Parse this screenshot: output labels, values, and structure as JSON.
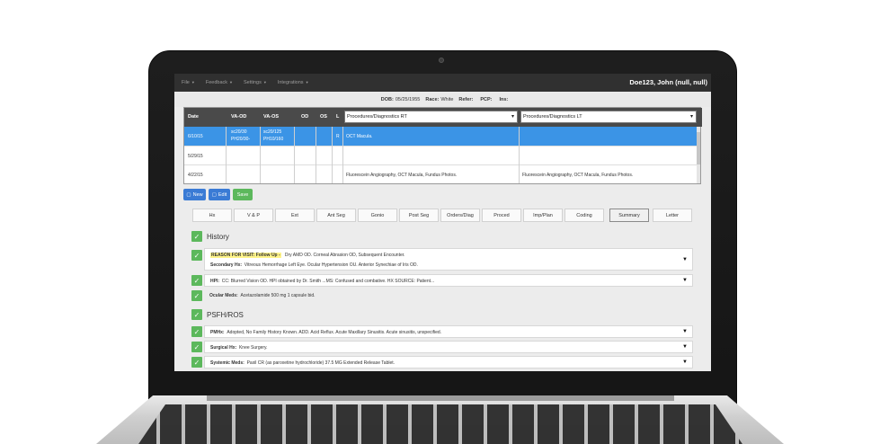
{
  "header": {
    "menus": [
      "File",
      "Feedback",
      "Settings",
      "Integrations"
    ],
    "patient_name": "Doe123, John (null, null)"
  },
  "infobar": {
    "dob_label": "DOB:",
    "dob": "05/25/1955",
    "race_label": "Race:",
    "race": "White",
    "refer_label": "Refer:",
    "pcp_label": "PCP:",
    "ins_label": "Ins:"
  },
  "grid": {
    "columns": [
      "Date",
      "VA-OD",
      "VA-OS",
      "OD",
      "OS",
      "L"
    ],
    "dropdown_rt": "Procedures/Diagnostics RT",
    "dropdown_lt": "Procedures/Diagnostics LT",
    "rows": [
      {
        "date": "6/10/15",
        "va_od_1": "sc20/30",
        "va_od_2": "PH20/30-",
        "va_os_1": "sc20/125",
        "va_os_2": "PH10/160",
        "l": "R",
        "rt": "OCT Macula.",
        "lt": ""
      },
      {
        "date": "5/29/15",
        "va_od_1": "",
        "va_od_2": "",
        "va_os_1": "",
        "va_os_2": "",
        "l": "",
        "rt": "",
        "lt": ""
      },
      {
        "date": "4/22/15",
        "va_od_1": "",
        "va_od_2": "",
        "va_os_1": "",
        "va_os_2": "",
        "l": "",
        "rt": "Fluorescein Angiography, OCT Macula, Fundus Photos.",
        "lt": "Fluorescein Angiography, OCT Macula, Fundus Photos."
      }
    ]
  },
  "buttons": {
    "new": "New",
    "edit": "Edit",
    "save": "Save"
  },
  "tabs": [
    "Hx",
    "V & P",
    "Ext",
    "Ant Seg",
    "Gonio",
    "Post Seg",
    "Orders/Diag",
    "Proced",
    "Imp/Plan",
    "Coding",
    "Summary",
    "Letter"
  ],
  "active_tab": "Summary",
  "history": {
    "title": "History",
    "reason_label": "REASON FOR VISIT: Follow Up -",
    "reason_text": "Dry AMD OD.  Corneal Abrasion OD, Subsequent Encounter.",
    "secondary_label": "Secondary Hx:",
    "secondary_text": "Vitreous Hemorrhage Left Eye.  Ocular Hypertension OU.  Anterior Synechiae of Iris OD.",
    "hpi_label": "HPI:",
    "hpi_text": "CC: Blurred Vision OD.   HPI obtained by Dr. Smith ...MS: Confused and combative. HX SOURCE: Patient...",
    "ocular_meds_label": "Ocular Meds:",
    "ocular_meds_text": "Acetazolamide 500 mg 1 capsule bid."
  },
  "psfh": {
    "title": "PSFH/ROS",
    "pmhx_label": "PMHx:",
    "pmhx_text": "Adopted, No Family History Known.    ADD.    Acid Reflux.    Acute Maxillary Sinusitis.    Acute sinusitis, unspecified.",
    "surgical_label": "Surgical Hx:",
    "surgical_text": "Knee Surgery.",
    "systemic_label": "Systemic Meds:",
    "systemic_text": "Paxil CR (as paroxetine hydrochloride) 37.5 MG Extended Release Tablet."
  },
  "colors": {
    "topbar": "#303030",
    "selected_row": "#3b94e6",
    "button_blue": "#3a7bd5",
    "button_green": "#5cb85c",
    "highlight": "#fff48a"
  }
}
